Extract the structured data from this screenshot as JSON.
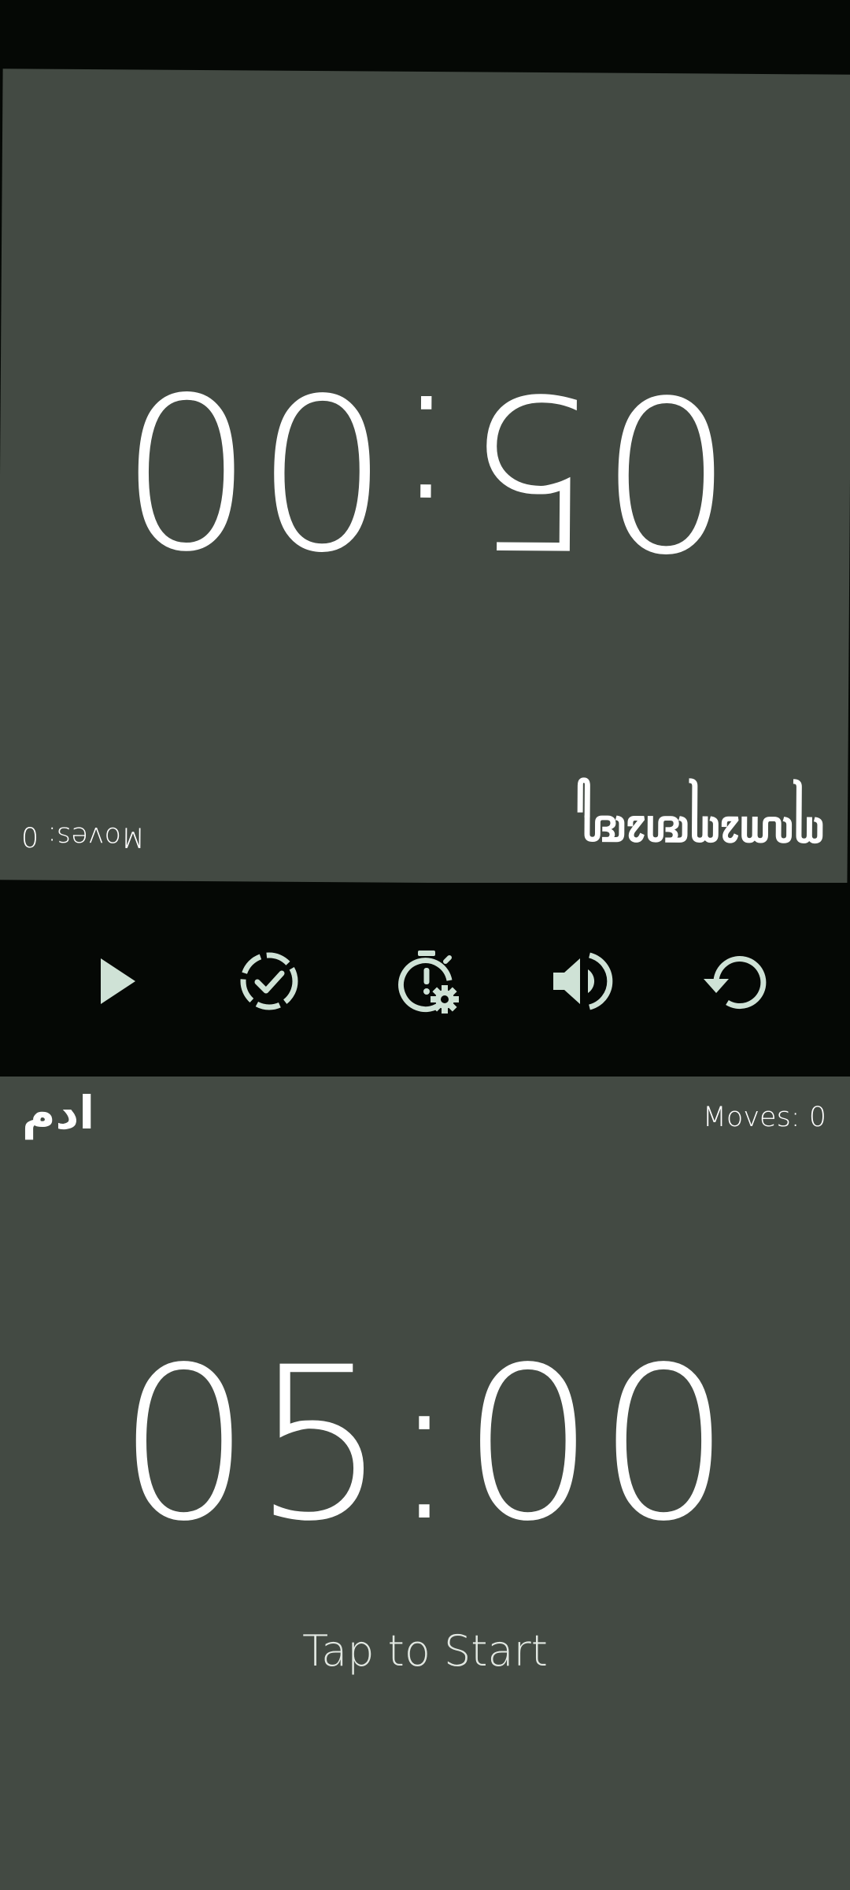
{
  "top_player": {
    "name": "ꦲꦺꦴꦩꦺꦴꦩꦸ",
    "time": "05:00",
    "moves": "Moves: 0"
  },
  "bottom_player": {
    "name": "ادم",
    "time": "05:00",
    "moves": "Moves: 0",
    "hint": "Tap to Start"
  },
  "toolbar": {
    "buttons": [
      {
        "name": "play",
        "icon": "play-icon"
      },
      {
        "name": "turn-check",
        "icon": "dashed-check-circle-icon"
      },
      {
        "name": "timer-settings",
        "icon": "timer-gear-icon"
      },
      {
        "name": "sound",
        "icon": "volume-icon"
      },
      {
        "name": "reset",
        "icon": "restart-icon"
      }
    ],
    "icon_color": "#cfe2d6"
  },
  "colors": {
    "panel": "#434a43",
    "background": "#050805",
    "text": "#ffffff"
  }
}
